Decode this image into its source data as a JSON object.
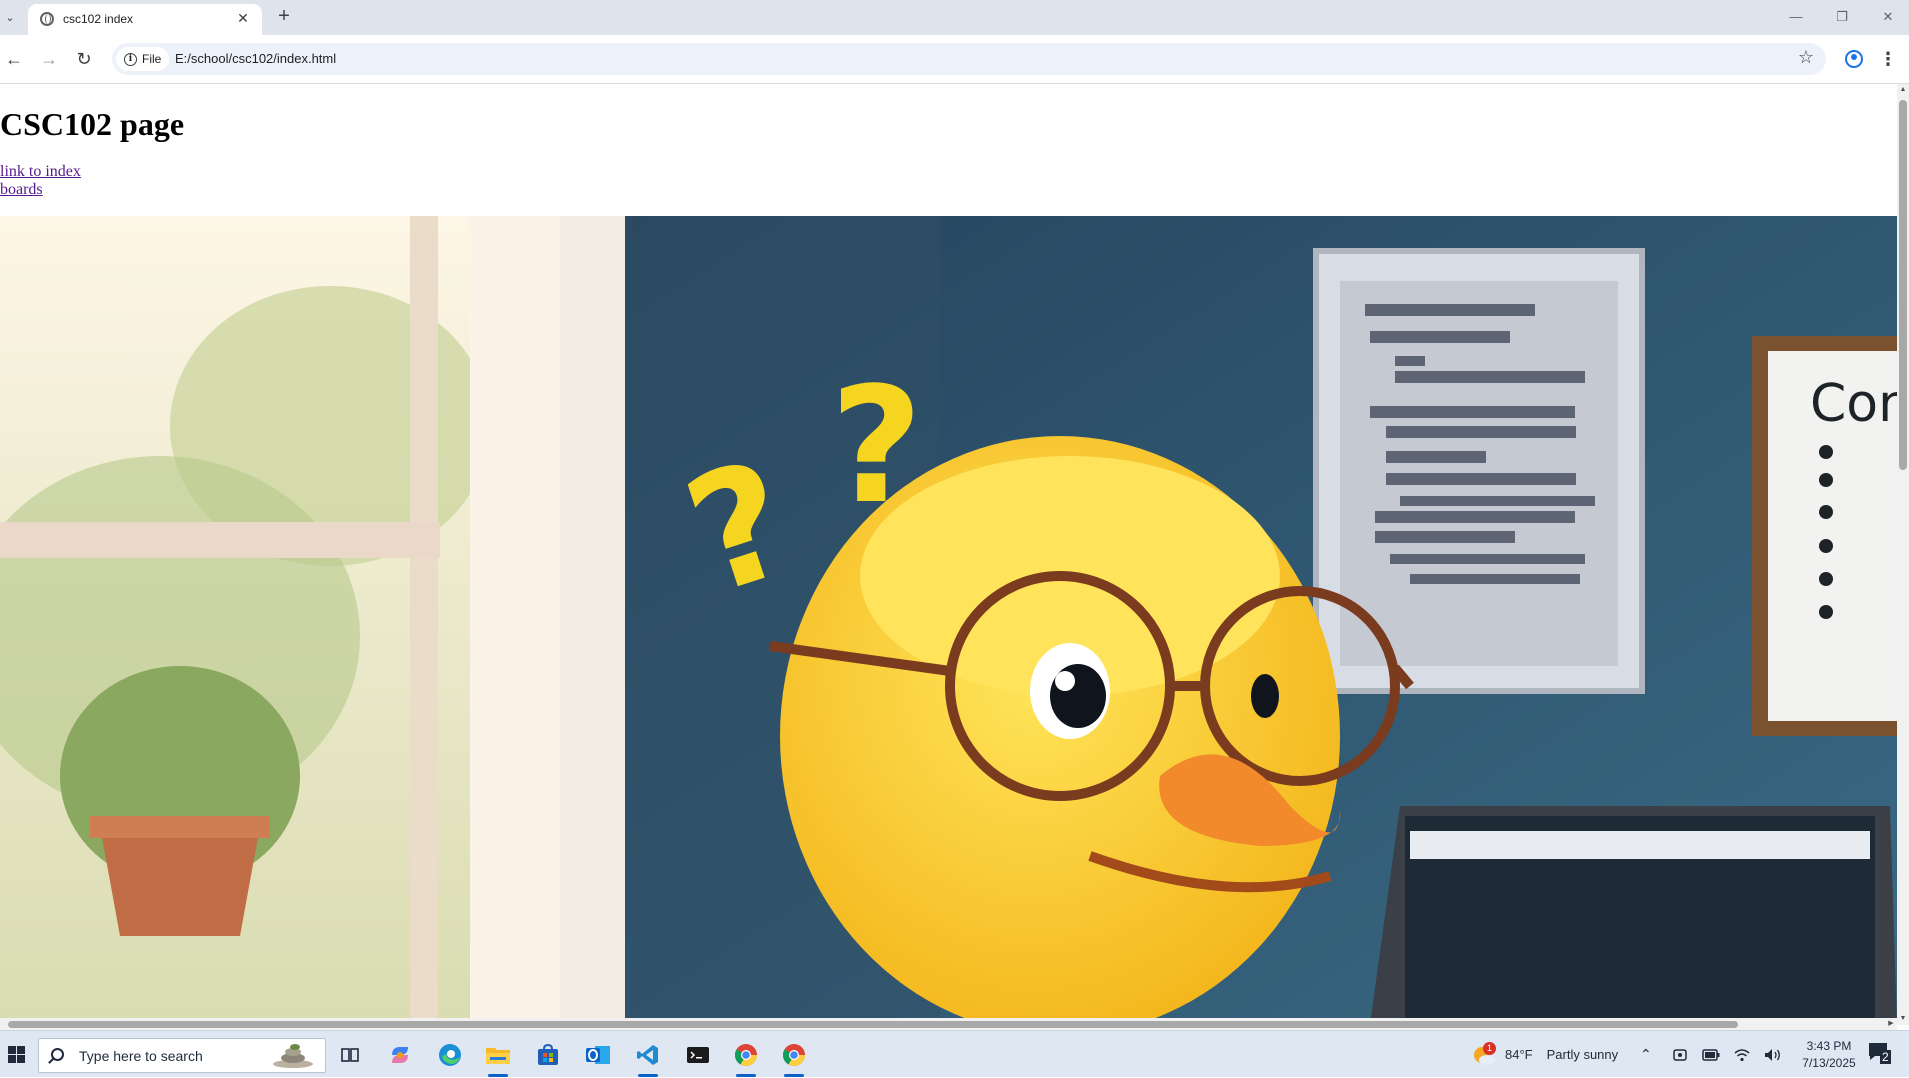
{
  "browser": {
    "tab": {
      "title": "csc102 index"
    },
    "omnibox": {
      "site_label": "File",
      "url": "E:/school/csc102/index.html"
    }
  },
  "page": {
    "heading": "CSC102 page",
    "links": [
      {
        "text": "link to index"
      },
      {
        "text": "boards"
      }
    ],
    "hero_image": {
      "question_marks": [
        "?",
        "?"
      ],
      "whiteboard_text": "Con"
    }
  },
  "taskbar": {
    "search_placeholder": "Type here to search",
    "weather": {
      "temp": "84°F",
      "condition": "Partly sunny",
      "badge": "1"
    },
    "clock": {
      "time": "3:43 PM",
      "date": "7/13/2025"
    },
    "notifications_count": "2",
    "apps": [
      "task-view",
      "copilot",
      "edge",
      "file-explorer",
      "microsoft-store",
      "outlook",
      "vscode",
      "terminal",
      "chrome",
      "chrome"
    ]
  },
  "colors": {
    "tabstrip": "#dfe4ec",
    "link_visited": "#551a8b",
    "taskbar": "#dfe7f3",
    "accent": "#0a64c8"
  }
}
